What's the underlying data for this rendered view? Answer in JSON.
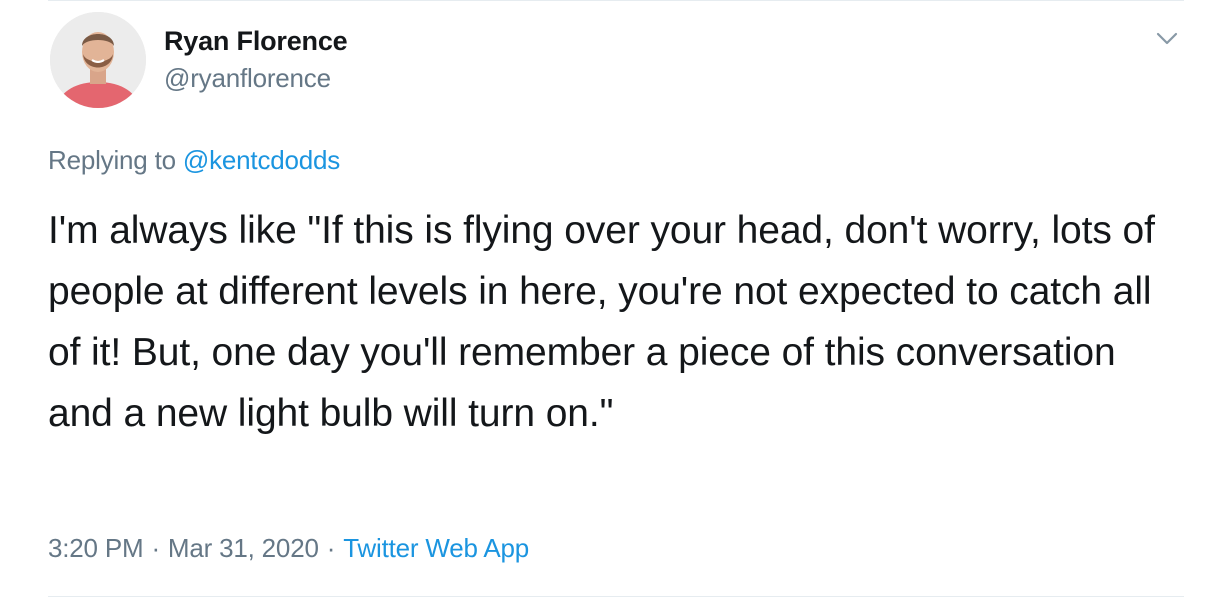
{
  "tweet": {
    "author": {
      "display_name": "Ryan Florence",
      "handle": "@ryanflorence"
    },
    "replying_to_prefix": "Replying to",
    "replying_to_handle": "@kentcdodds",
    "text": "I'm always like \"If this is flying over your head, don't worry, lots of people at different levels in here, you're not expected to catch all of it! But, one day you'll remember a piece of this conversation and a new light bulb will turn on.\"",
    "time": "3:20 PM",
    "date": "Mar 31, 2020",
    "separator": "·",
    "source": "Twitter Web App"
  },
  "icons": {
    "caret": "chevron-down-icon"
  },
  "colors": {
    "link": "#1b95e0",
    "secondary_text": "#657786",
    "primary_text": "#14171a",
    "divider": "#e6ecf0"
  }
}
